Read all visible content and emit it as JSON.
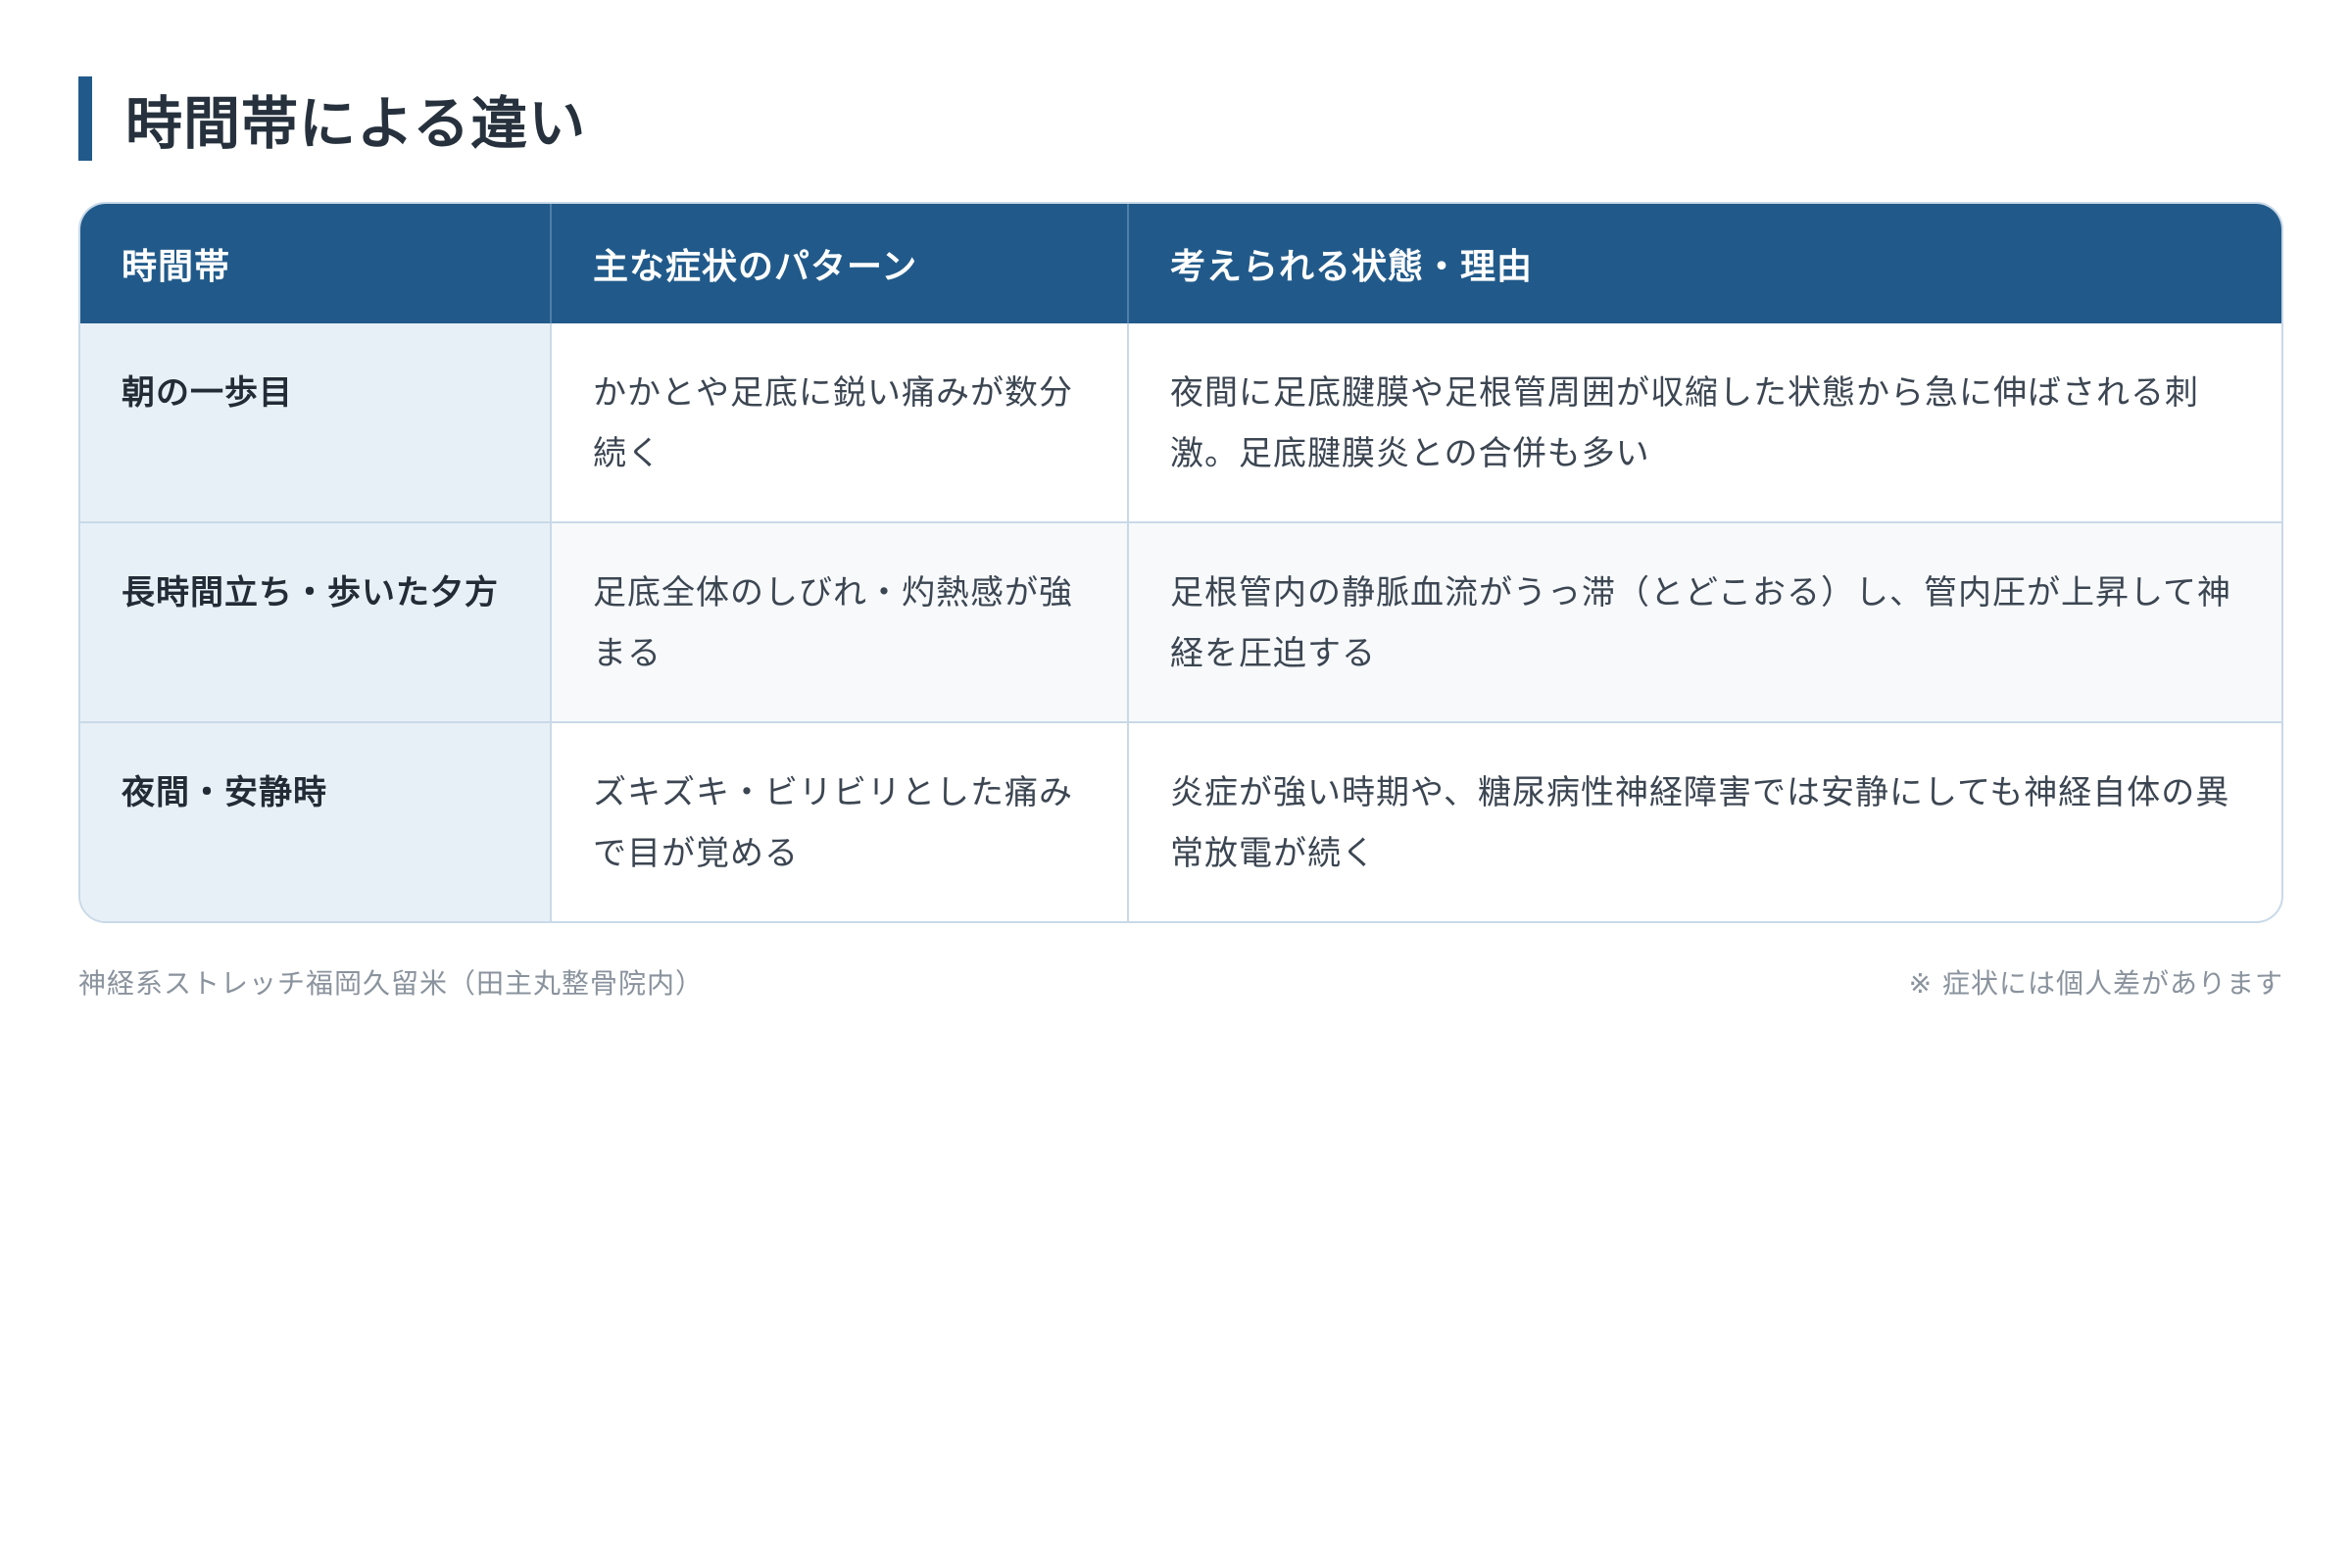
{
  "title": "時間帯による違い",
  "table": {
    "headers": [
      "時間帯",
      "主な症状のパターン",
      "考えられる状態・理由"
    ],
    "rows": [
      {
        "time": "朝の一歩目",
        "symptom": "かかとや足底に鋭い痛みが数分続く",
        "reason": "夜間に足底腱膜や足根管周囲が収縮した状態から急に伸ばされる刺激。足底腱膜炎との合併も多い"
      },
      {
        "time": "長時間立ち・歩いた夕方",
        "symptom": "足底全体のしびれ・灼熱感が強まる",
        "reason": "足根管内の静脈血流がうっ滞（とどこおる）し、管内圧が上昇して神経を圧迫する"
      },
      {
        "time": "夜間・安静時",
        "symptom": "ズキズキ・ビリビリとした痛みで目が覚める",
        "reason": "炎症が強い時期や、糖尿病性神経障害では安静にしても神経自体の異常放電が続く"
      }
    ]
  },
  "footer": {
    "source": "神経系ストレッチ福岡久留米（田主丸整骨院内）",
    "note": "※ 症状には個人差があります"
  },
  "colors": {
    "accent": "#215a8a",
    "label_bg": "#e8f0f7",
    "border": "#c9d9e8"
  }
}
